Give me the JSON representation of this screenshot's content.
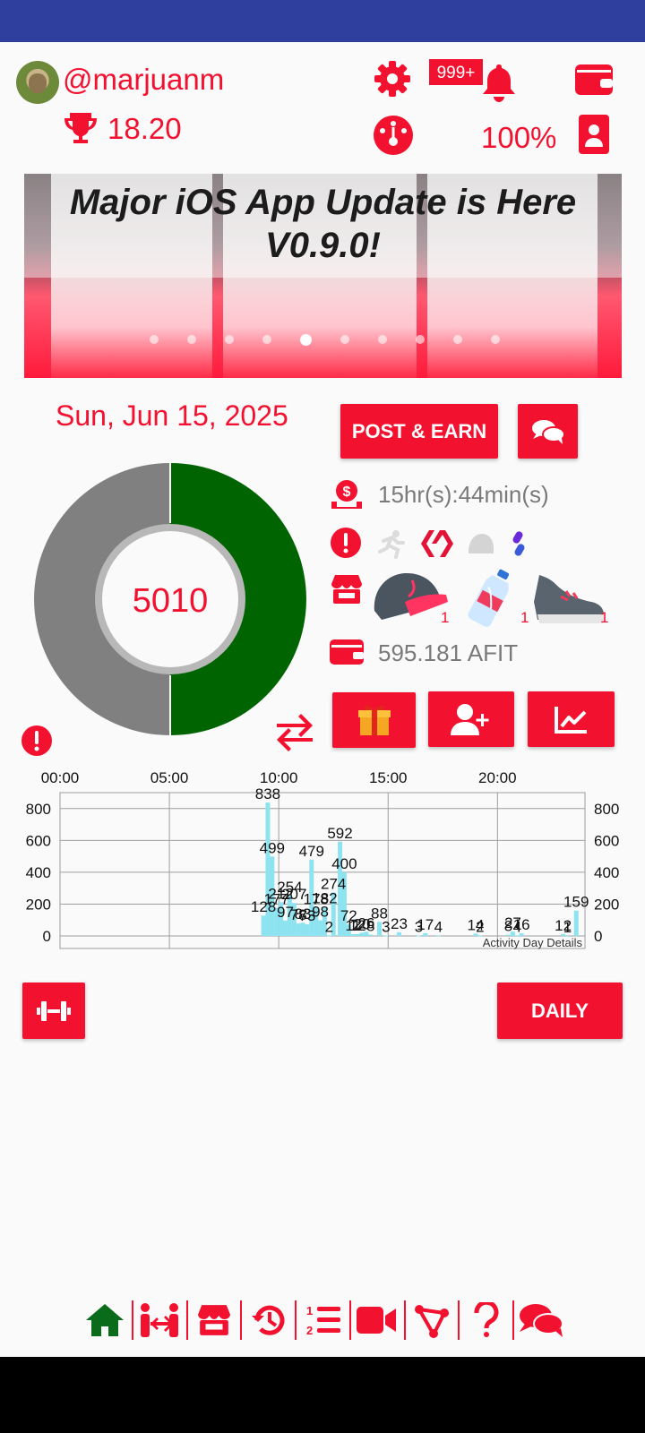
{
  "profile": {
    "username": "@marjuanm",
    "score": "18.20"
  },
  "header": {
    "notifications_badge": "999+",
    "battery_percent": "100%"
  },
  "banner": {
    "headline_line1": "Major iOS App Update is Here",
    "headline_line2": "V0.9.0!",
    "slide_count": 10,
    "active_slide": 5
  },
  "day": {
    "date": "Sun, Jun 15, 2025",
    "steps": "5010",
    "progress": 0.5
  },
  "actions": {
    "post_earn_label": "POST & EARN",
    "daily_label": "DAILY"
  },
  "stats": {
    "time_remaining": "15hr(s):44min(s)",
    "gear": [
      {
        "name": "cap",
        "count": "1"
      },
      {
        "name": "water-bottle",
        "count": "1"
      },
      {
        "name": "sneaker",
        "count": "1"
      }
    ],
    "wallet_balance": "595.181 AFIT"
  },
  "colors": {
    "accent": "#f2112f",
    "progress": "#006400",
    "remaining": "#808080",
    "bars": "#8ee3f0",
    "nav_active": "#0a6b1a"
  },
  "chart_data": {
    "type": "bar",
    "title": "",
    "annotation": "Activity Day Details",
    "x_ticks": [
      "00:00",
      "05:00",
      "10:00",
      "15:00",
      "20:00"
    ],
    "y_ticks": [
      "0",
      "200",
      "400",
      "600",
      "800"
    ],
    "ylim": [
      0,
      900
    ],
    "x_range_hours": [
      0,
      24
    ],
    "bars": [
      {
        "t": 9.3,
        "v": 128
      },
      {
        "t": 9.5,
        "v": 838
      },
      {
        "t": 9.7,
        "v": 499
      },
      {
        "t": 9.9,
        "v": 177
      },
      {
        "t": 10.1,
        "v": 212
      },
      {
        "t": 10.3,
        "v": 97
      },
      {
        "t": 10.5,
        "v": 254
      },
      {
        "t": 10.7,
        "v": 207
      },
      {
        "t": 10.9,
        "v": 78
      },
      {
        "t": 11.1,
        "v": 83
      },
      {
        "t": 11.3,
        "v": 73
      },
      {
        "t": 11.5,
        "v": 479
      },
      {
        "t": 11.7,
        "v": 178
      },
      {
        "t": 11.9,
        "v": 98
      },
      {
        "t": 12.1,
        "v": 182
      },
      {
        "t": 12.3,
        "v": 2
      },
      {
        "t": 12.5,
        "v": 274
      },
      {
        "t": 12.8,
        "v": 592
      },
      {
        "t": 13.0,
        "v": 400
      },
      {
        "t": 13.2,
        "v": 72
      },
      {
        "t": 13.4,
        "v": 11
      },
      {
        "t": 13.6,
        "v": 12
      },
      {
        "t": 13.8,
        "v": 20
      },
      {
        "t": 14.0,
        "v": 26
      },
      {
        "t": 14.2,
        "v": 8
      },
      {
        "t": 14.6,
        "v": 88
      },
      {
        "t": 14.9,
        "v": 3
      },
      {
        "t": 15.5,
        "v": 23
      },
      {
        "t": 16.4,
        "v": 3
      },
      {
        "t": 16.7,
        "v": 17
      },
      {
        "t": 17.3,
        "v": 4
      },
      {
        "t": 19.0,
        "v": 14
      },
      {
        "t": 19.2,
        "v": 2
      },
      {
        "t": 20.5,
        "v": 8
      },
      {
        "t": 20.7,
        "v": 27
      },
      {
        "t": 20.9,
        "v": 4
      },
      {
        "t": 21.1,
        "v": 16
      },
      {
        "t": 23.0,
        "v": 12
      },
      {
        "t": 23.2,
        "v": 1
      },
      {
        "t": 23.6,
        "v": 159
      }
    ]
  }
}
